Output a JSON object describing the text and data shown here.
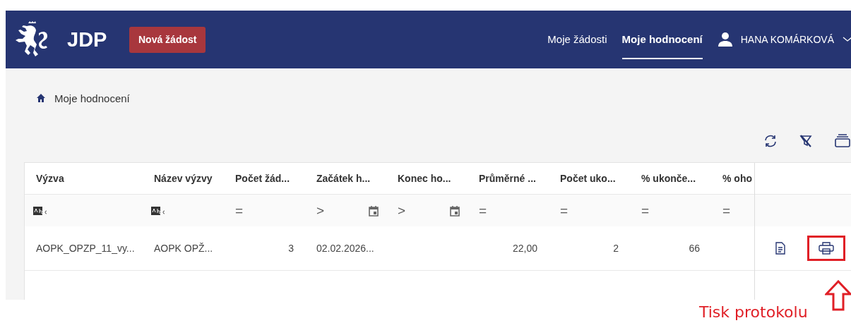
{
  "header": {
    "logo_text": "JDP",
    "new_button": "Nová žádost",
    "nav": [
      {
        "label": "Moje žádosti",
        "selected": false
      },
      {
        "label": "Moje hodnocení",
        "selected": true
      }
    ],
    "user": "HANA KOMÁRKOVÁ"
  },
  "breadcrumb": "Moje hodnocení",
  "table": {
    "columns": [
      {
        "label": "Výzva",
        "kind": "text",
        "filter": {
          "kind": "text"
        }
      },
      {
        "label": "Název výzvy",
        "kind": "text",
        "filter": {
          "kind": "text"
        }
      },
      {
        "label": "Počet žád...",
        "kind": "number",
        "filter": {
          "kind": "number",
          "operator": "="
        }
      },
      {
        "label": "Začátek h...",
        "kind": "text",
        "filter": {
          "kind": "date",
          "operator": ">"
        }
      },
      {
        "label": "Konec ho...",
        "kind": "text",
        "filter": {
          "kind": "date",
          "operator": ">"
        }
      },
      {
        "label": "Průměrné ...",
        "kind": "number",
        "filter": {
          "kind": "number",
          "operator": "="
        }
      },
      {
        "label": "Počet uko...",
        "kind": "number",
        "filter": {
          "kind": "number",
          "operator": "="
        }
      },
      {
        "label": "% ukonče...",
        "kind": "number",
        "filter": {
          "kind": "number",
          "operator": "="
        }
      },
      {
        "label": "% oho",
        "kind": "number",
        "filter": {
          "kind": "number",
          "operator": "="
        }
      }
    ],
    "rows": [
      {
        "cells": [
          "AOPK_OPZP_11_vy...",
          "AOPK OPŽ...",
          "3",
          "02.02.2026...",
          "",
          "22,00",
          "2",
          "66",
          ""
        ]
      }
    ]
  },
  "annotation": {
    "label": "Tisk protokolu"
  }
}
